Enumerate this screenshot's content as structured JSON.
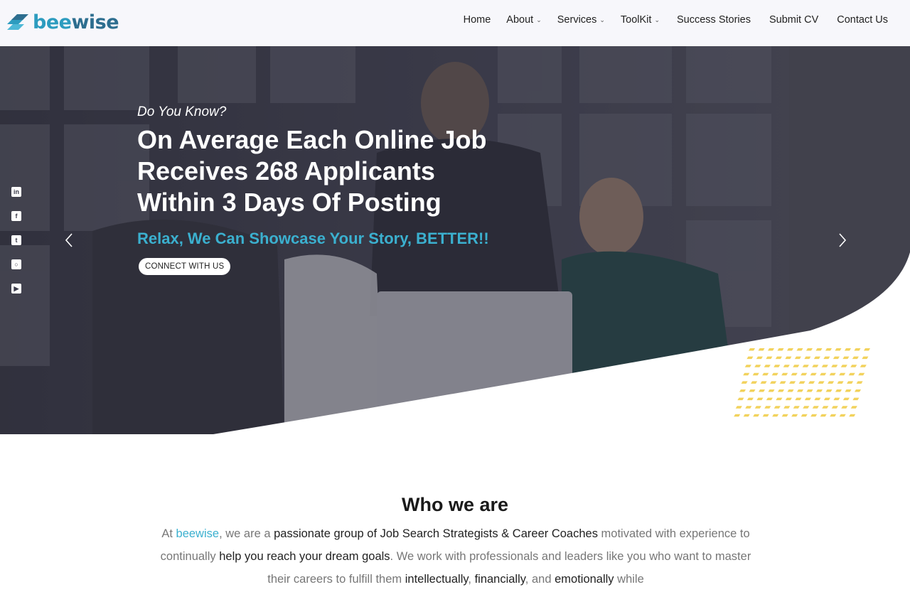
{
  "logo": {
    "part1": "bee",
    "part2": "wise"
  },
  "nav": {
    "items": [
      {
        "label": "Home",
        "dropdown": false
      },
      {
        "label": "About",
        "dropdown": true
      },
      {
        "label": "Services",
        "dropdown": true
      },
      {
        "label": "ToolKit",
        "dropdown": true
      },
      {
        "label": "Success Stories",
        "dropdown": false
      },
      {
        "label": "Submit CV",
        "dropdown": false
      },
      {
        "label": "Contact Us",
        "dropdown": false
      }
    ]
  },
  "hero": {
    "eyebrow": "Do You Know?",
    "headline_line1": "On Average Each Online Job",
    "headline_line2": "Receives 268 Applicants",
    "headline_line3": "Within 3 Days Of Posting",
    "subhead": "Relax, We Can Showcase Your Story, BETTER!!",
    "cta_label": "CONNECT WITH US",
    "social": [
      "linkedin-icon",
      "facebook-icon",
      "twitter-icon",
      "instagram-icon",
      "youtube-icon"
    ]
  },
  "who": {
    "title": "Who we are",
    "p1": "At ",
    "brand": "beewise",
    "p2": ", we are a ",
    "e1": "passionate group of Job Search Strategists & Career Coaches",
    "p3": " motivated with experience to continually ",
    "e2": "help you reach your dream goals",
    "p4": ". We work with professionals and leaders like you who want to master their careers to fulfill them ",
    "e3": "intellectually",
    "p5": ", ",
    "e4": "financially",
    "p6": ", and ",
    "e5": "emotionally",
    "p7": " while"
  },
  "colors": {
    "accent": "#3bb0cf",
    "dots": "#f2d25c",
    "overlay": "#2a2a3a"
  }
}
